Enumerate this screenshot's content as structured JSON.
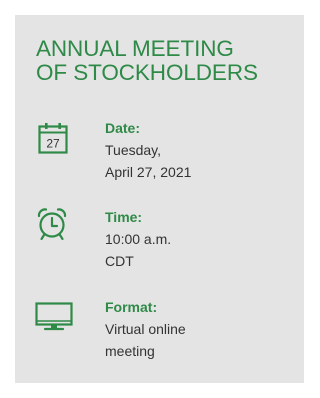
{
  "title": {
    "line1": "ANNUAL MEETING",
    "line2": "OF STOCKHOLDERS"
  },
  "date": {
    "label": "Date:",
    "line1": "Tuesday,",
    "line2": "April 27, 2021",
    "calendar_day": "27",
    "icon": "calendar-icon"
  },
  "time": {
    "label": "Time:",
    "line1": "10:00 a.m.",
    "line2": "CDT",
    "icon": "alarm-clock-icon"
  },
  "format": {
    "label": "Format:",
    "line1": "Virtual online",
    "line2": "meeting",
    "icon": "monitor-icon"
  },
  "colors": {
    "accent": "#2f8a48",
    "panel": "#e4e4e4",
    "text": "#333333"
  }
}
